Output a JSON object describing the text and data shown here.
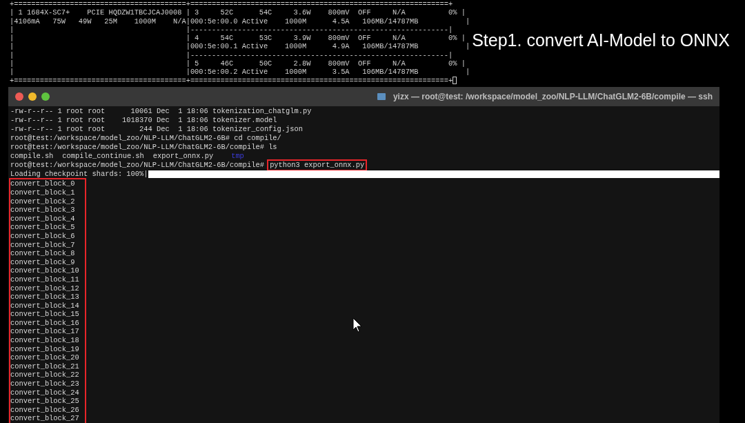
{
  "background_terminal": {
    "lines": [
      "+========================================+============================================================+",
      "| 1 1684X-SC7+    PCIE HQDZW1TBCJCAJ0008 | 3     52C      54C     3.6W    800mV  OFF     N/A          0% |",
      "|4106mA   75W   49W   25M    1000M    N/A|000:5e:00.0 Active    1000M      4.5A   106MB/14787MB           |",
      "|                                        |------------------------------------------------------------|",
      "|                                        | 4     54C      53C     3.9W    800mV  OFF     N/A          0% |",
      "|                                        |000:5e:00.1 Active    1000M      4.9A   106MB/14787MB           |",
      "|                                        |------------------------------------------------------------|",
      "|                                        | 5     46C      50C     2.8W    800mV  OFF     N/A          0% |",
      "|                                        |000:5e:00.2 Active    1000M      3.5A   106MB/14787MB           |",
      "+========================================+============================================================+"
    ],
    "cursor": true
  },
  "annotation": "Step1. convert AI-Model to ONNX",
  "window": {
    "title": "yizx — root@test: /workspace/model_zoo/NLP-LLM/ChatGLM2-6B/compile — ssh",
    "lines": [
      {
        "kind": "text",
        "text": "-rw-r--r-- 1 root root      10061 Dec  1 18:06 tokenization_chatglm.py"
      },
      {
        "kind": "text",
        "text": "-rw-r--r-- 1 root root    1018370 Dec  1 18:06 tokenizer.model"
      },
      {
        "kind": "text",
        "text": "-rw-r--r-- 1 root root        244 Dec  1 18:06 tokenizer_config.json"
      },
      {
        "kind": "command",
        "prompt": "root@test:/workspace/model_zoo/NLP-LLM/ChatGLM2-6B#",
        "command": "cd compile/",
        "highlighted": false
      },
      {
        "kind": "command",
        "prompt": "root@test:/workspace/model_zoo/NLP-LLM/ChatGLM2-6B/compile#",
        "command": "ls",
        "highlighted": false
      },
      {
        "kind": "listing",
        "items": [
          {
            "text": "compile.sh",
            "directory": false
          },
          {
            "text": "compile_continue.sh",
            "directory": false
          },
          {
            "text": "export_onnx.py",
            "directory": false
          },
          {
            "text": "tmp",
            "directory": true
          }
        ]
      },
      {
        "kind": "command",
        "prompt": "root@test:/workspace/model_zoo/NLP-LLM/ChatGLM2-6B/compile#",
        "command": "python3 export_onnx.py",
        "highlighted": true
      },
      {
        "kind": "progress",
        "text": "Loading checkpoint shards: 100%|",
        "level": 1
      }
    ],
    "highlighted_output": [
      "convert_block_0",
      "convert_block_1",
      "convert_block_2",
      "convert_block_3",
      "convert_block_4",
      "convert_block_5",
      "convert_block_6",
      "convert_block_7",
      "convert_block_8",
      "convert_block_9",
      "convert_block_10",
      "convert_block_11",
      "convert_block_12",
      "convert_block_13",
      "convert_block_14",
      "convert_block_15",
      "convert_block_16",
      "convert_block_17",
      "convert_block_18",
      "convert_block_19",
      "convert_block_20",
      "convert_block_21",
      "convert_block_22",
      "convert_block_23",
      "convert_block_24",
      "convert_block_25",
      "convert_block_26",
      "convert_block_27"
    ]
  }
}
